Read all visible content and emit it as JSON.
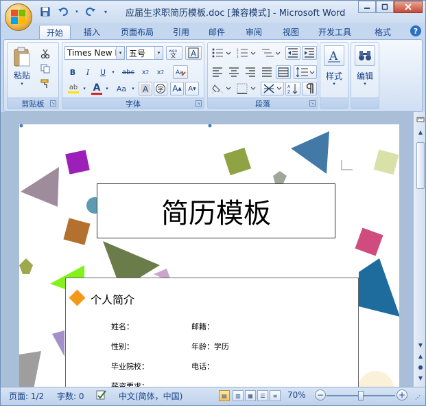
{
  "window": {
    "title": "应届生求职简历模板.doc [兼容模式] - Microsoft Word"
  },
  "tabs": [
    "开始",
    "插入",
    "页面布局",
    "引用",
    "邮件",
    "审阅",
    "视图",
    "开发工具",
    "格式"
  ],
  "ribbon": {
    "clipboard": {
      "label": "剪贴板",
      "paste": "粘贴"
    },
    "font": {
      "label": "字体",
      "font_name": "Times New R",
      "font_size": "五号"
    },
    "paragraph": {
      "label": "段落"
    },
    "styles": {
      "label": "样式"
    },
    "editing": {
      "label": "编辑"
    }
  },
  "document": {
    "heading": "简历模板",
    "section_title": "个人简介",
    "fields": {
      "name": "姓名：",
      "native_place": "邮籍：",
      "gender": "性别：",
      "age_education": "年龄：学历",
      "school": "毕业院校：",
      "phone": "电话：",
      "salary": "薪资要求："
    }
  },
  "statusbar": {
    "page": "页面: 1/2",
    "word_count": "字数: 0",
    "language": "中文(简体，中国)",
    "zoom": "70%",
    "zoom_fraction": 0.5
  },
  "colors": {
    "accent_orange": "#f29a18",
    "ribbon_blue": "#15428b",
    "font_color_red": "#e02020",
    "highlight_yellow": "#ffe100"
  }
}
